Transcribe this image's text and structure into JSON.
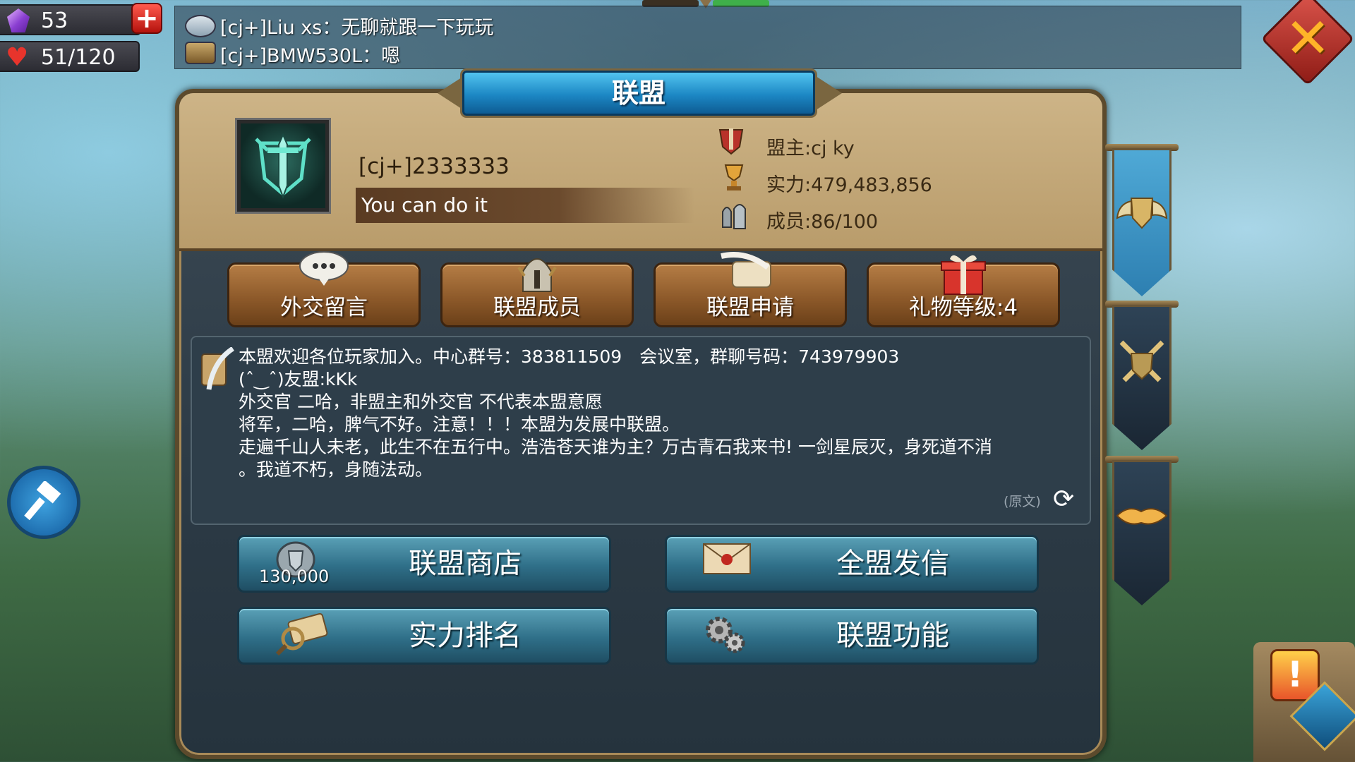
{
  "resources": {
    "gems": "53",
    "stamina": "51/120"
  },
  "chat": {
    "messages": [
      {
        "text": "[cj+]Liu xs：无聊就跟一下玩玩"
      },
      {
        "text": "[cj+]BMW530L：嗯"
      }
    ]
  },
  "panel": {
    "title": "联盟",
    "alliance_name": "[cj+]2333333",
    "motto": "You can do it",
    "leader": "盟主:cj ky",
    "power": "实力:479,483,856",
    "members": "成员:86/100"
  },
  "tabs": [
    {
      "label": "外交留言",
      "icon": "speech-bubble-icon"
    },
    {
      "label": "联盟成员",
      "icon": "helmet-icon"
    },
    {
      "label": "联盟申请",
      "icon": "scroll-quill-icon"
    },
    {
      "label": "礼物等级:4",
      "icon": "gift-icon"
    }
  ],
  "announcement": {
    "lines": [
      "本盟欢迎各位玩家加入。中心群号：383811509　会议室，群聊号码：743979903",
      "(ˆ‿ˆ)友盟:kKk",
      "外交官 二哈，非盟主和外交官 不代表本盟意愿",
      "将军，二哈，脾气不好。注意！！！本盟为发展中联盟。",
      "走遍千山人未老，此生不在五行中。浩浩苍天谁为主？万古青石我来书! 一剑星辰灭，身死道不消",
      "。我道不朽，身随法动。"
    ],
    "original_label": "(原文)"
  },
  "actions": {
    "shop": {
      "label": "联盟商店",
      "currency": "130,000"
    },
    "mail": {
      "label": "全盟发信"
    },
    "ranking": {
      "label": "实力排名"
    },
    "functions": {
      "label": "联盟功能"
    }
  },
  "colors": {
    "panel_info_bg": "#cdb487",
    "banner_blue": "#1c87c4",
    "tab_brown": "#8a5728",
    "action_teal": "#2f6f88",
    "close_red": "#d9534a"
  }
}
